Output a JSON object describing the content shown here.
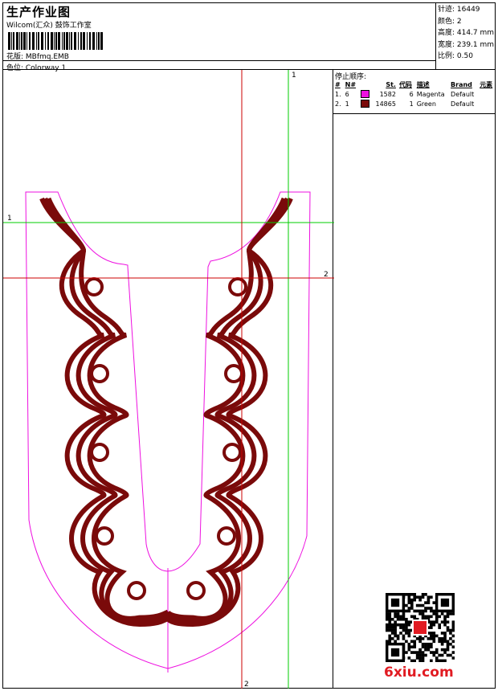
{
  "header": {
    "title": "生产作业图",
    "subtitle": "Wilcom(汇众) 鼓饰工作室",
    "design_name": "花版: MBfmq.EMB",
    "colorway": "色位: Colorway 1"
  },
  "stats": [
    "针迹: 16449",
    "颜色: 2",
    "高度: 414.7 mm",
    "宽度: 239.1 mm",
    "比例: 0.50"
  ],
  "stop_sequence": {
    "heading": "停止顺序:",
    "columns": [
      "#",
      "N#",
      "St.",
      "代码",
      "描述",
      "Brand",
      "元素"
    ],
    "rows": [
      {
        "index": "1.",
        "n": "6",
        "color": "#ee10e0",
        "stitches": "1582",
        "code": "6",
        "desc": "Magenta",
        "brand": "Default"
      },
      {
        "index": "2.",
        "n": "1",
        "color": "#7a0a0a",
        "stitches": "14865",
        "code": "1",
        "desc": "Green",
        "brand": "Default"
      }
    ]
  },
  "guides": {
    "h1": "1",
    "h2": "2",
    "v1": "1",
    "v2": "2"
  },
  "colors": {
    "magenta": "#ee10e0",
    "maroon": "#7a0a0a",
    "guide_green": "#00cc00",
    "guide_red": "#cc0000"
  },
  "watermark": {
    "logo": "6xiu.com"
  }
}
